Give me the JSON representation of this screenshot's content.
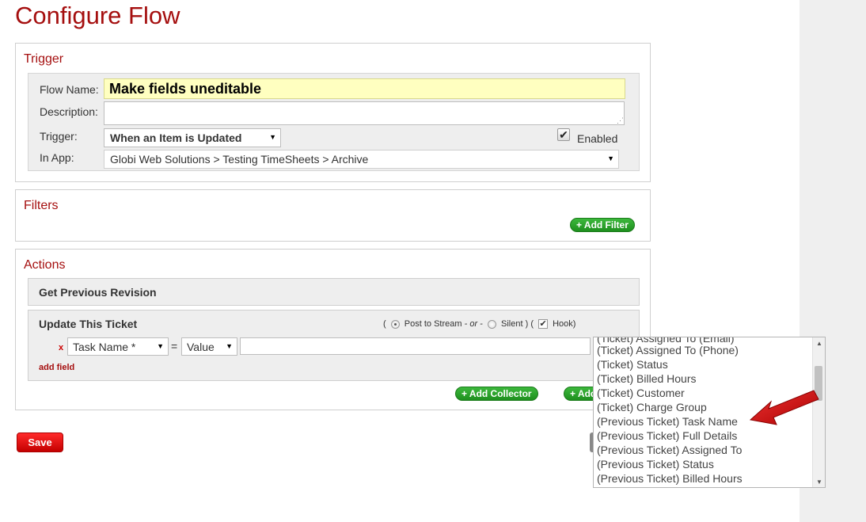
{
  "page": {
    "title": "Configure Flow"
  },
  "trigger": {
    "title": "Trigger",
    "flow_name_label": "Flow Name:",
    "flow_name_value": "Make fields uneditable",
    "description_label": "Description:",
    "description_value": "",
    "trigger_label": "Trigger:",
    "trigger_value": "When an Item is Updated",
    "enabled_label": "Enabled",
    "enabled_checked": true,
    "in_app_label": "In App:",
    "in_app_value": "Globi Web Solutions > Testing TimeSheets > Archive"
  },
  "filters": {
    "title": "Filters",
    "add_filter": "+ Add Filter"
  },
  "actions": {
    "title": "Actions",
    "get_previous": "Get Previous Revision",
    "update_title": "Update This Ticket",
    "mode": {
      "open_paren": "(",
      "post_to_stream": "Post to Stream",
      "or": "- or -",
      "silent": "Silent",
      "close_paren": ")",
      "hook_paren": "(",
      "hook": "Hook)"
    },
    "remove_x": "x",
    "field_select": "Task Name *",
    "equals": "=",
    "type_select": "Value",
    "add_field": "add field",
    "add_collector": "+ Add Collector",
    "add_other": "+ Add"
  },
  "save_label": "Save",
  "dropdown": {
    "items": [
      "(Ticket) Assigned To (Email)",
      "(Ticket) Assigned To (Phone)",
      "(Ticket) Status",
      "(Ticket) Billed Hours",
      "(Ticket) Customer",
      "(Ticket) Charge Group",
      "(Previous Ticket) Task Name",
      "(Previous Ticket) Full Details",
      "(Previous Ticket) Assigned To",
      "(Previous Ticket) Status",
      "(Previous Ticket) Billed Hours"
    ],
    "highlighted": "(Previous Ticket) Task Name"
  },
  "colors": {
    "accent": "#a50f0f",
    "green": "#22a022",
    "highlight_input": "#ffffc0",
    "arrow": "#cc1111"
  }
}
